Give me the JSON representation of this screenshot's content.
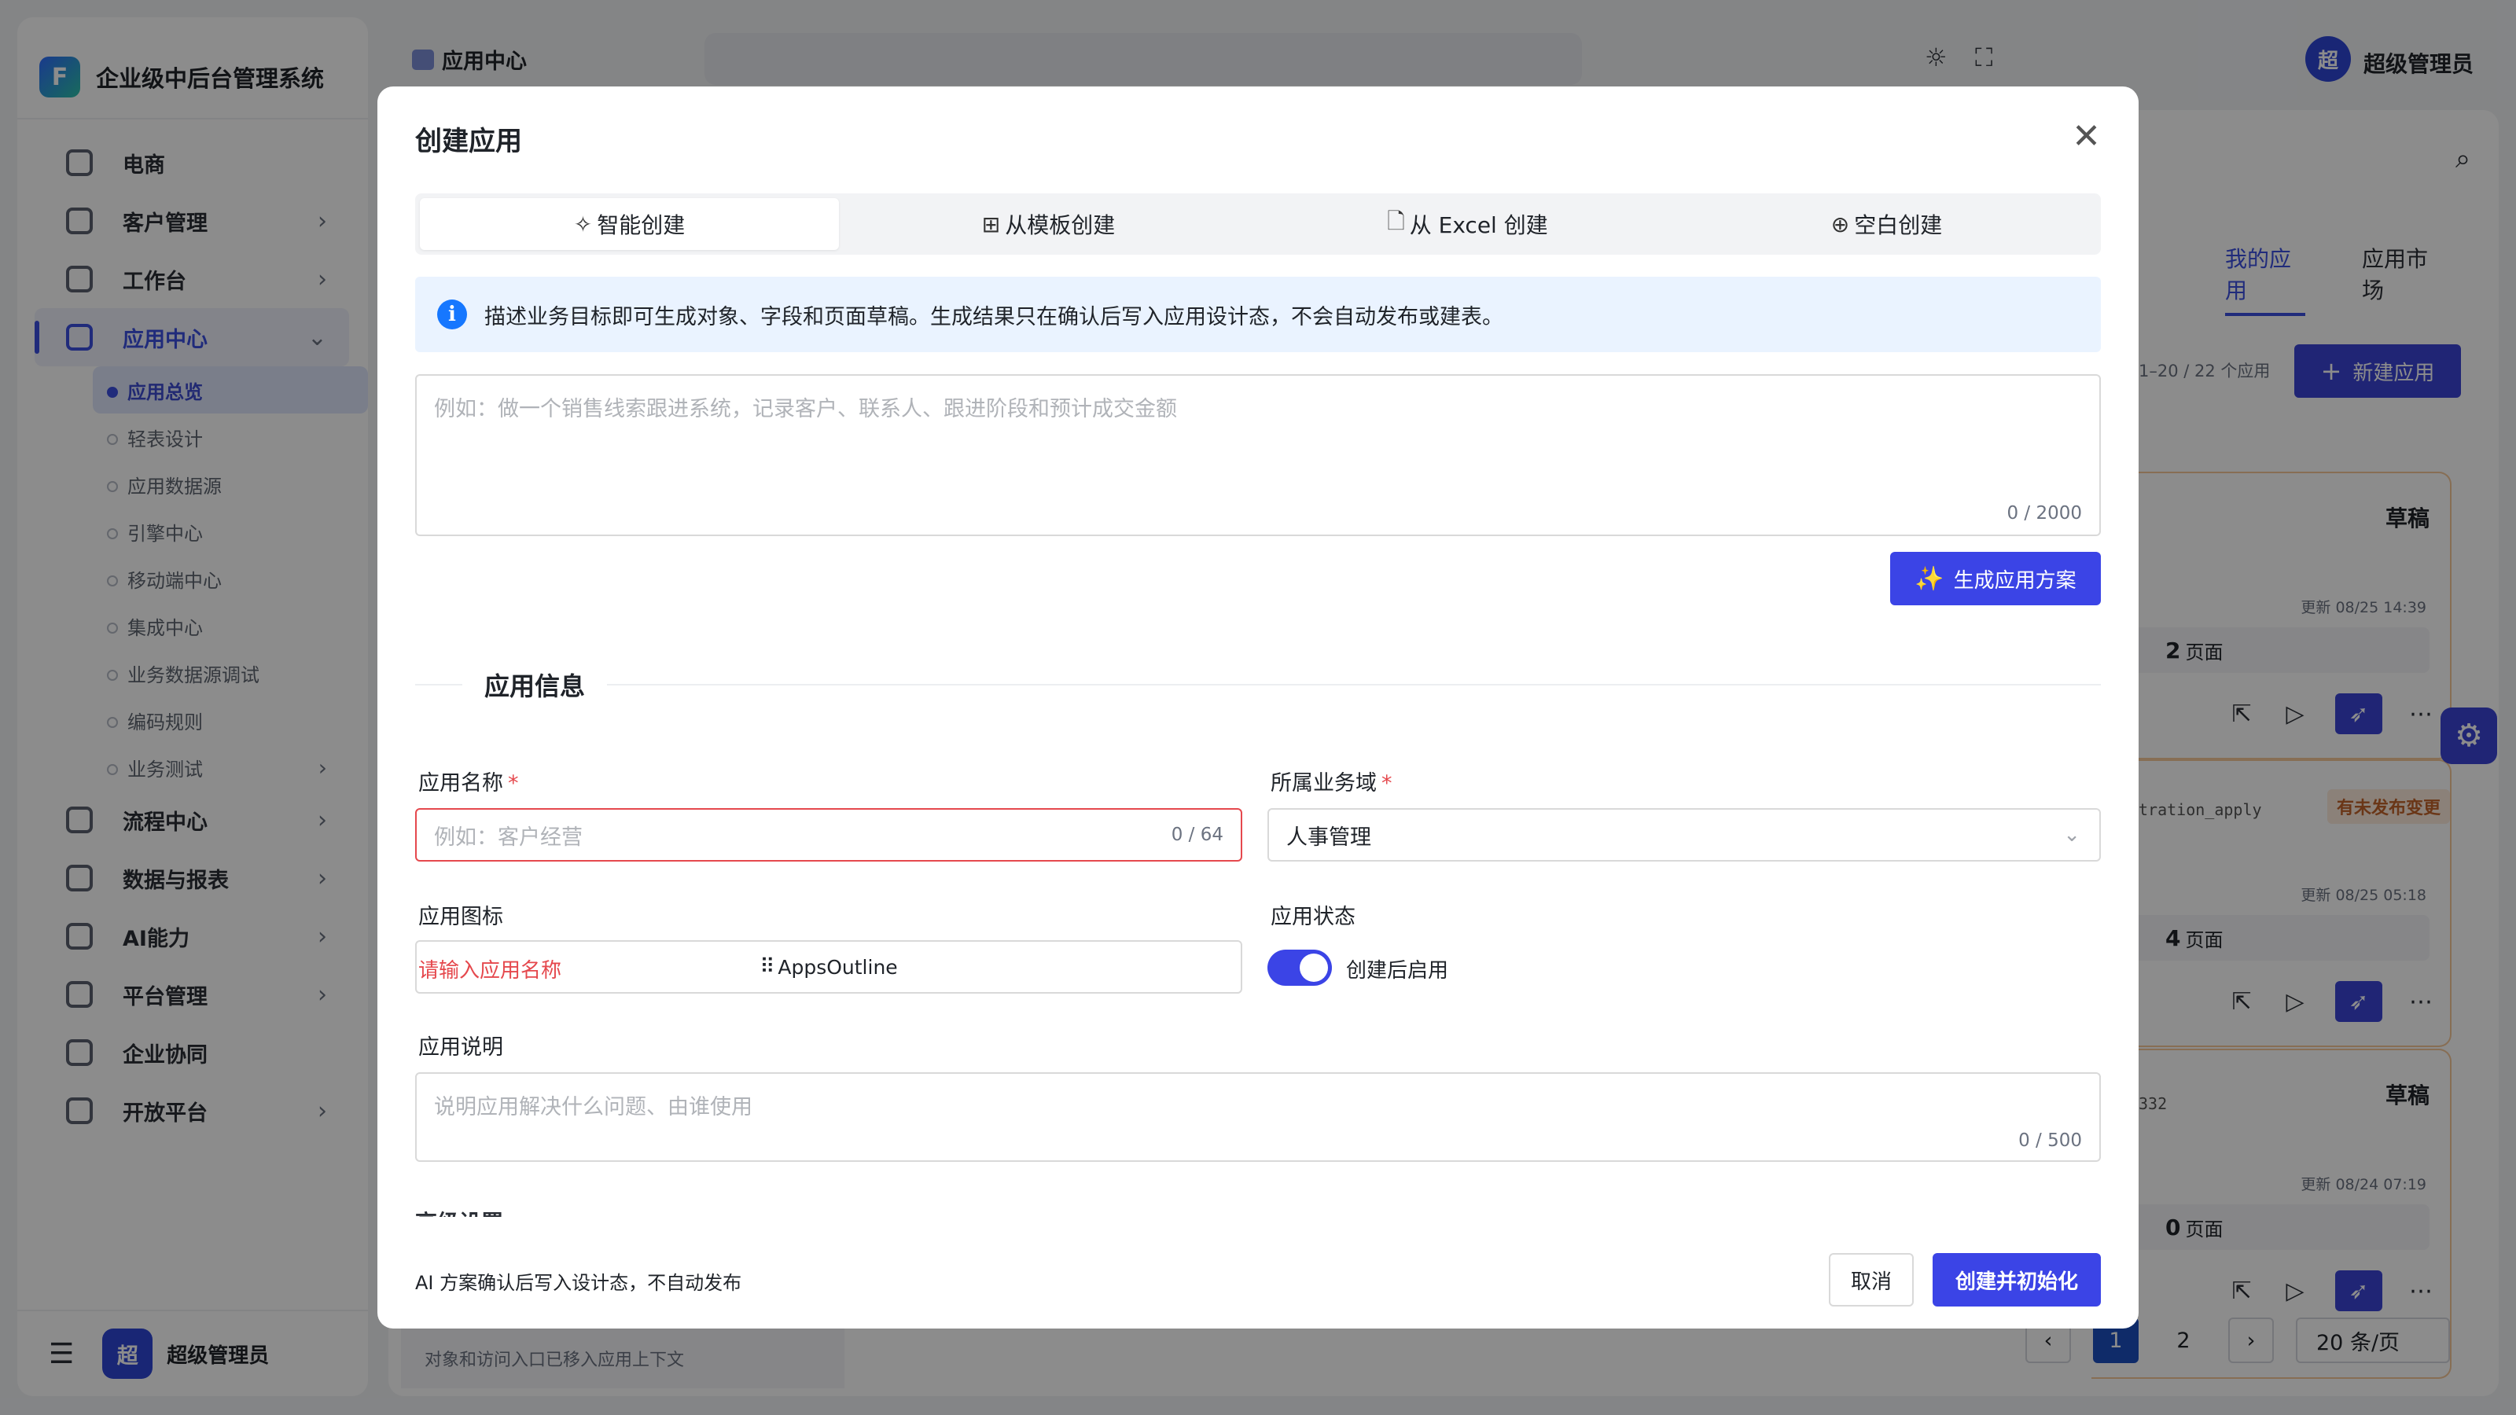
{
  "app": {
    "title": "企业级中后台管理系统",
    "logo_letter": "F"
  },
  "sidebar": {
    "items": [
      {
        "label": "电商",
        "icon": "bag-icon"
      },
      {
        "label": "客户管理",
        "icon": "person-icon"
      },
      {
        "label": "工作台",
        "icon": "clipboard-icon"
      },
      {
        "label": "应用中心",
        "icon": "app-center-icon"
      },
      {
        "label": "流程中心",
        "icon": "flow-icon"
      },
      {
        "label": "数据与报表",
        "icon": "report-icon"
      },
      {
        "label": "AI能力",
        "icon": "ai-icon"
      },
      {
        "label": "平台管理",
        "icon": "platform-icon"
      },
      {
        "label": "企业协同",
        "icon": "collab-icon"
      },
      {
        "label": "开放平台",
        "icon": "open-platform-icon"
      }
    ],
    "subitems": [
      {
        "label": "应用总览"
      },
      {
        "label": "轻表设计"
      },
      {
        "label": "应用数据源"
      },
      {
        "label": "引擎中心"
      },
      {
        "label": "移动端中心"
      },
      {
        "label": "集成中心"
      },
      {
        "label": "业务数据源调试"
      },
      {
        "label": "编码规则"
      },
      {
        "label": "业务测试"
      }
    ],
    "footer": {
      "avatar": "超",
      "name": "超级管理员"
    }
  },
  "topbar": {
    "breadcrumb": "应用中心",
    "avatar": "超",
    "user": "超级管理员"
  },
  "background": {
    "tabs": [
      "我的应用",
      "应用市场"
    ],
    "count": "1–20 / 22 个应用",
    "new_button": "新建应用",
    "cards": [
      {
        "badge": "草稿",
        "code": "",
        "updated": "更新 08/25 14:39",
        "pages_num": "2",
        "pages_unit": "页面"
      },
      {
        "badge": "有未发布变更",
        "code": "tration_apply",
        "updated": "更新 08/25 05:18",
        "pages_num": "4",
        "pages_unit": "页面"
      },
      {
        "badge": "草稿",
        "code": "332",
        "updated": "更新 08/24 07:19",
        "pages_num": "0",
        "pages_unit": "页面"
      }
    ],
    "bottom_note": "对象和访问入口已移入应用上下文",
    "pager": {
      "pages": [
        "1",
        "2"
      ],
      "size": "20 条/页"
    }
  },
  "modal": {
    "title": "创建应用",
    "tabs": [
      {
        "label": "智能创建",
        "icon": "sparkle-icon"
      },
      {
        "label": "从模板创建",
        "icon": "template-grid-icon"
      },
      {
        "label": "从 Excel 创建",
        "icon": "file-icon"
      },
      {
        "label": "空白创建",
        "icon": "plus-circle-icon"
      }
    ],
    "alert": "描述业务目标即可生成对象、字段和页面草稿。生成结果只在确认后写入应用设计态，不会自动发布或建表。",
    "prompt": {
      "placeholder": "例如：做一个销售线索跟进系统，记录客户、联系人、跟进阶段和预计成交金额",
      "count": "0 / 2000"
    },
    "generate_button": "生成应用方案",
    "section_title": "应用信息",
    "name": {
      "label": "应用名称",
      "placeholder": "例如：客户经营",
      "count": "0 / 64",
      "error": "请输入应用名称"
    },
    "domain": {
      "label": "所属业务域",
      "value": "人事管理"
    },
    "icon_field": {
      "label": "应用图标",
      "value": "AppsOutline"
    },
    "status": {
      "label": "应用状态",
      "toggle_label": "创建后启用",
      "enabled": true
    },
    "description": {
      "label": "应用说明",
      "placeholder": "说明应用解决什么问题、由谁使用",
      "count": "0 / 500"
    },
    "advanced_peek": "高级设置",
    "footer_note": "AI 方案确认后写入设计态，不自动发布",
    "cancel": "取消",
    "confirm": "创建并初始化"
  },
  "colors": {
    "primary": "#3b44e6",
    "error": "#e5484d",
    "info_bg": "#eaf3ff",
    "info_icon": "#1677ff"
  }
}
